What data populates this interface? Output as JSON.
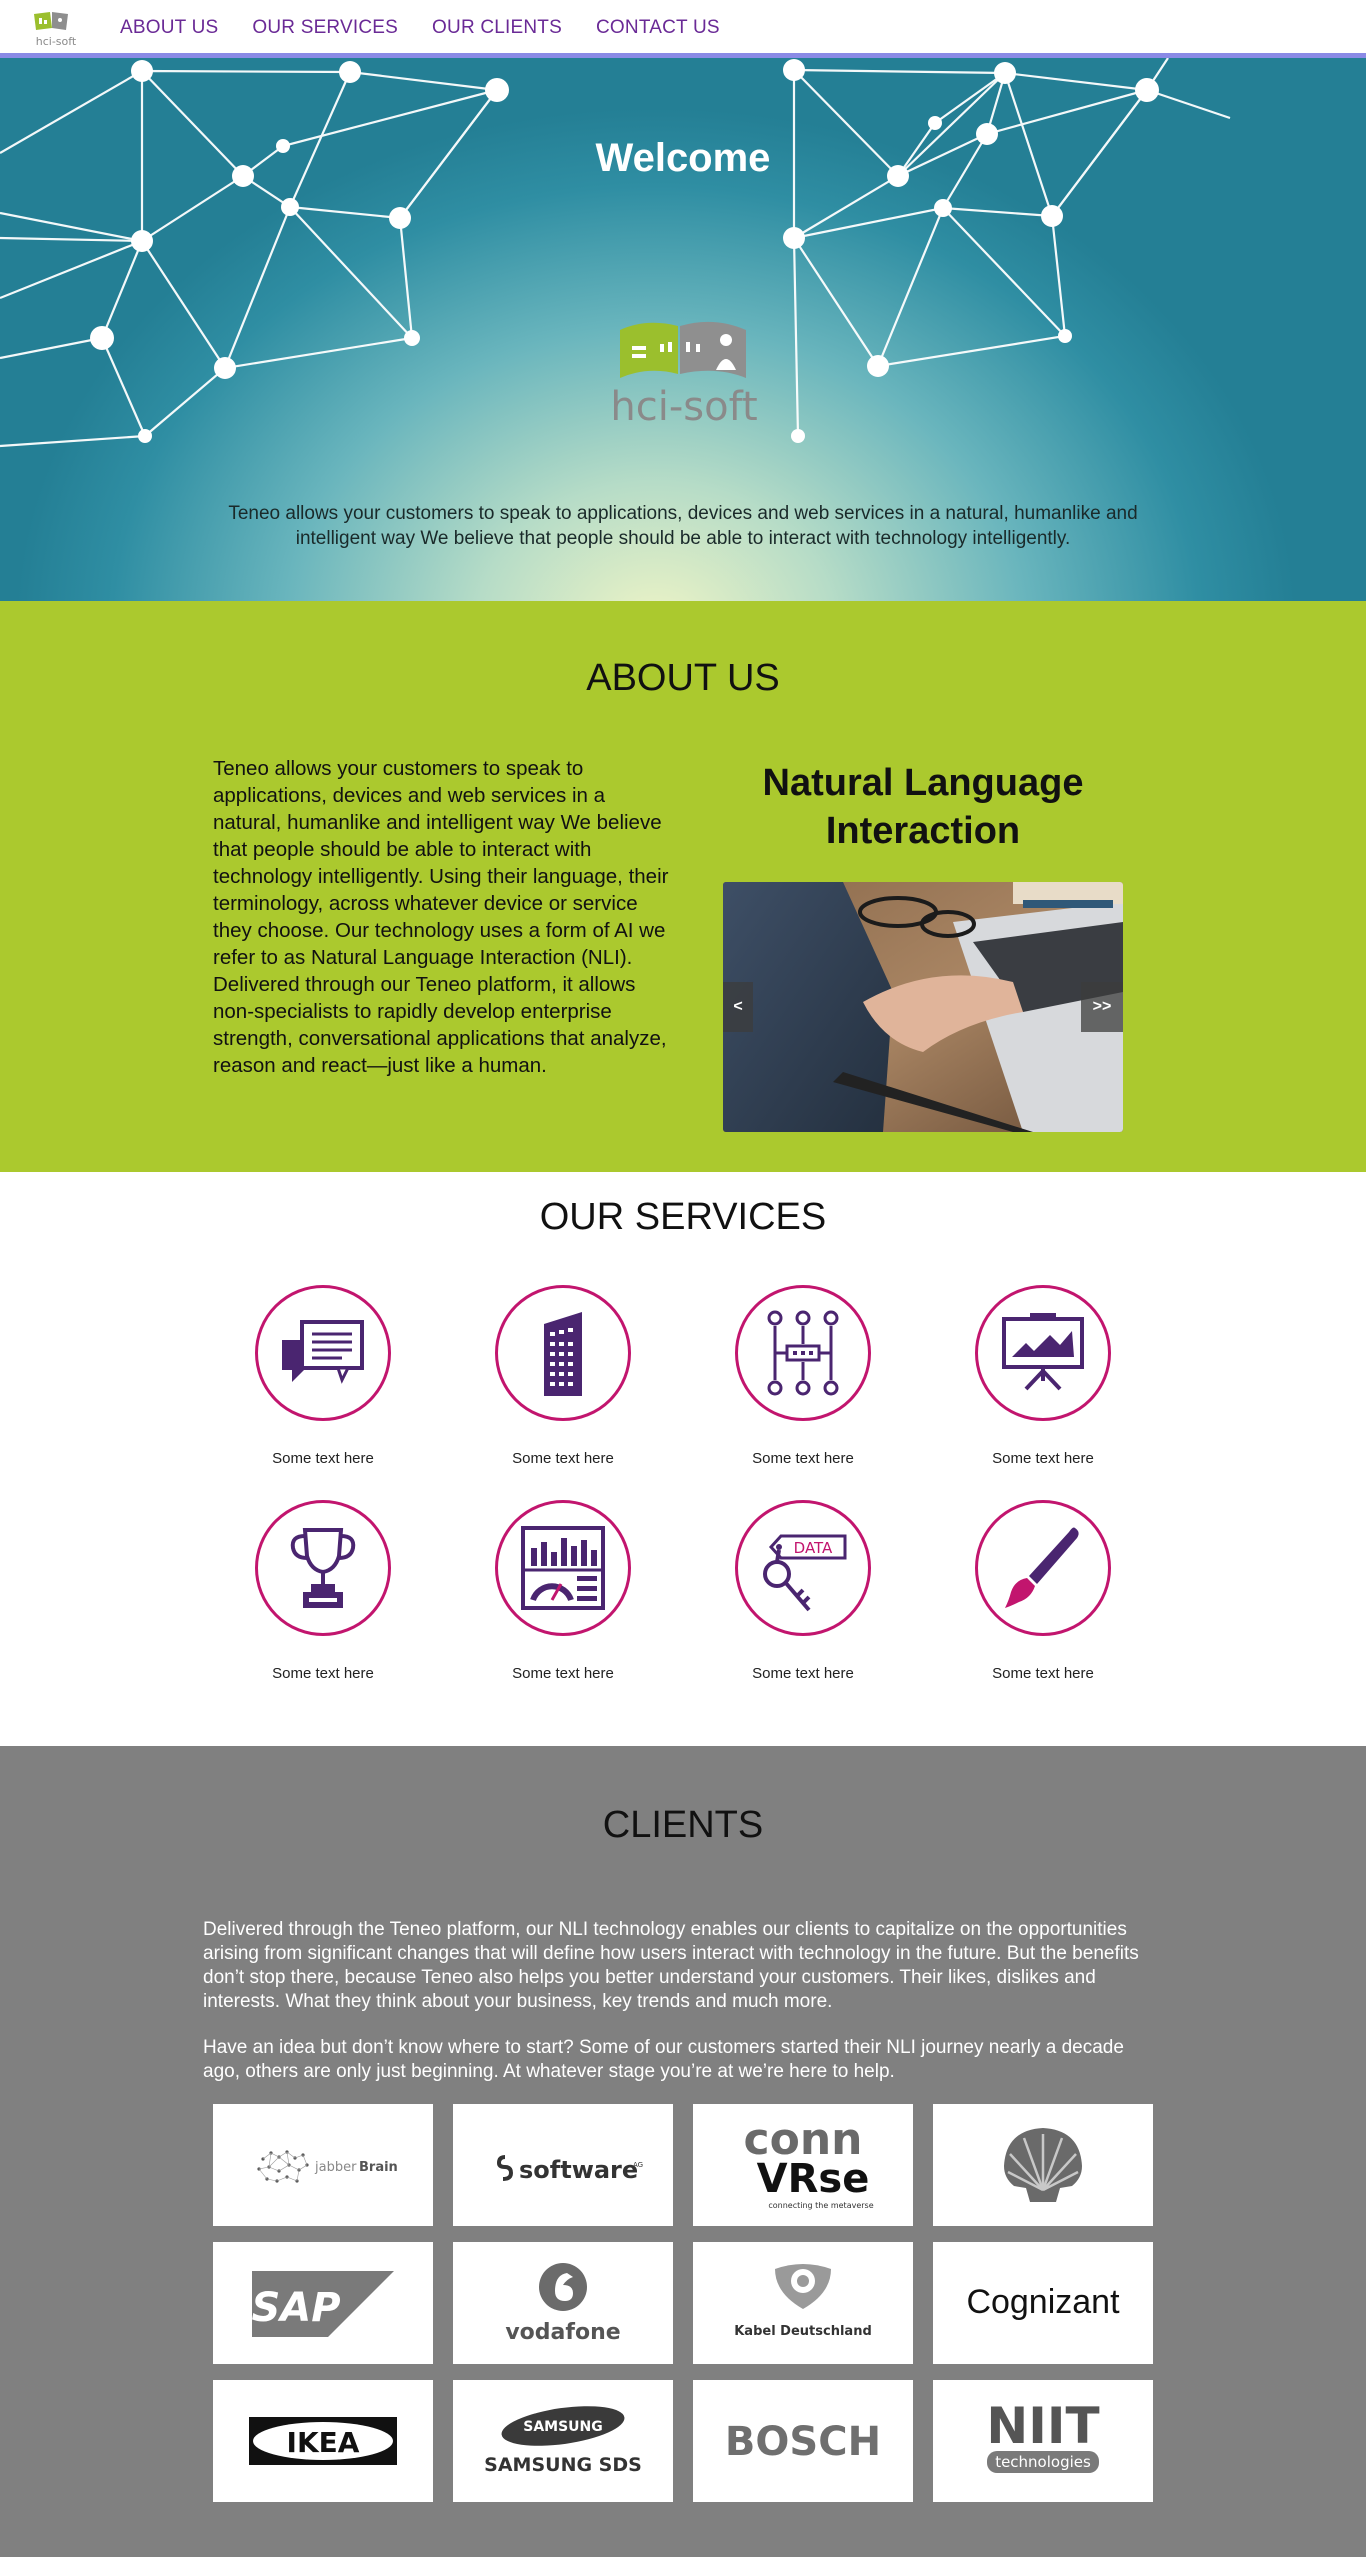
{
  "nav": {
    "logo_text": "hci-soft",
    "links": [
      "ABOUT US",
      "OUR SERVICES",
      "OUR CLIENTS",
      "CONTACT US"
    ]
  },
  "hero": {
    "title": "Welcome",
    "logo_text": "hci-soft",
    "text": "Teneo allows your customers to speak to applications, devices and web services in a natural, humanlike and intelligent way We believe that people should be able to interact with technology intelligently."
  },
  "about": {
    "heading": "ABOUT US",
    "body": "Teneo allows your customers to speak to applications, devices and web services in a natural, humanlike and intelligent way We believe that people should be able to interact with technology intelligently. Using their language, their terminology, across whatever device or service they choose. Our technology uses a form of AI we refer to as Natural Language Interaction (NLI). Delivered through our Teneo platform, it allows non-specialists to rapidly develop enterprise strength, conversational applications that analyze, reason and react—just like a human.",
    "feature_title": "Natural Language Interaction",
    "slider_prev": "<",
    "slider_next": ">>"
  },
  "services": {
    "heading": "OUR SERVICES",
    "items": [
      {
        "icon": "chat-document-icon",
        "label": "Some text here"
      },
      {
        "icon": "building-icon",
        "label": "Some text here"
      },
      {
        "icon": "workflow-diagram-icon",
        "label": "Some text here"
      },
      {
        "icon": "presentation-board-icon",
        "label": "Some text here"
      },
      {
        "icon": "trophy-icon",
        "label": "Some text here"
      },
      {
        "icon": "dashboard-icon",
        "label": "Some text here"
      },
      {
        "icon": "data-key-icon",
        "label": "Some text here"
      },
      {
        "icon": "paintbrush-icon",
        "label": "Some text here"
      }
    ],
    "data_tag": "DATA"
  },
  "clients": {
    "heading": "CLIENTS",
    "paragraph1": "Delivered through the Teneo platform, our NLI technology enables our clients to capitalize on the opportunities arising from significant changes that will define how users interact with technology in the future. But the benefits don’t stop there, because Teneo also helps you better understand your customers. Their likes, dislikes and interests. What they think about your business, key trends and much more.",
    "paragraph2": "Have an idea but don’t know where to start? Some of our customers started their NLI journey nearly a decade ago, others are only just beginning. At whatever stage you’re at we’re here to help.",
    "logos": {
      "jabberbrain_a": "jabber",
      "jabberbrain_b": "Brain",
      "software": "software",
      "software_ag": "AG",
      "connverse_a": "conn",
      "connverse_b": "VRse",
      "connverse_tag": "connecting the metaverse",
      "sap": "SAP",
      "vodafone": "vodafone",
      "kabel": "Kabel Deutschland",
      "cognizant": "Cognizant",
      "ikea": "IKEA",
      "samsung": "SAMSUNG",
      "samsung_sds": "SAMSUNG SDS",
      "bosch": "BOSCH",
      "niit": "NIIT",
      "niit_tag": "technologies"
    }
  },
  "colors": {
    "nav_link": "#6a2a96",
    "nav_border": "#8a8ae6",
    "about_bg": "#abc92e",
    "service_ring": "#c2156e",
    "icon_purple": "#4a2570",
    "clients_bg": "#808080"
  }
}
